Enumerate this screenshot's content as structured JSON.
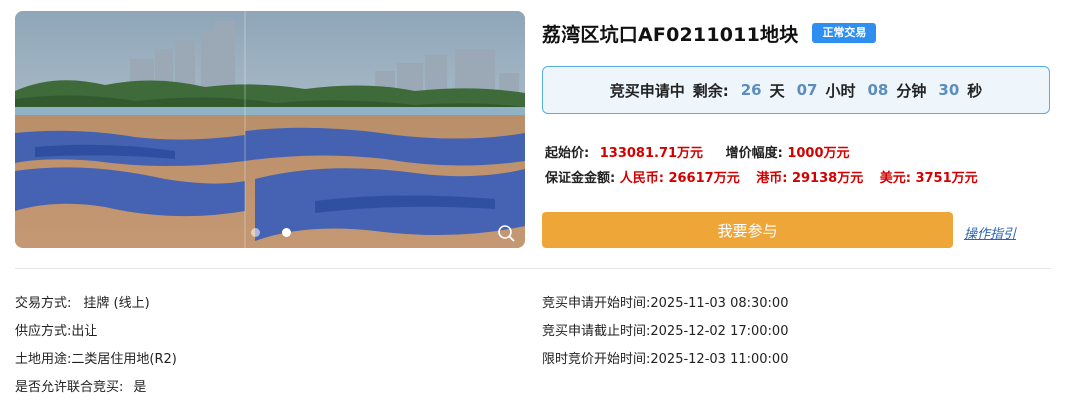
{
  "gallery": {
    "dot_count": 2,
    "active_dot": 1,
    "zoom_icon": "zoom-icon"
  },
  "title": "荔湾区坑口AF0211011地块",
  "badge": "正常交易",
  "countdown": {
    "status": "竞买申请中",
    "remaining_label": "剩余:",
    "days": "26",
    "days_unit": "天",
    "hours": "07",
    "hours_unit": "小时",
    "minutes": "08",
    "minutes_unit": "分钟",
    "seconds": "30",
    "seconds_unit": "秒"
  },
  "prices": {
    "start_label": "起始价:",
    "start_value": "133081.71万元",
    "increment_label": "增价幅度:",
    "increment_value": "1000万元",
    "deposit_label": "保证金金额:",
    "rmb_label": "人民币:",
    "rmb_value": "26617万元",
    "hkd_label": "港币:",
    "hkd_value": "29138万元",
    "usd_label": "美元:",
    "usd_value": "3751万元"
  },
  "join_button": "我要参与",
  "guide_link": "操作指引",
  "details_left": [
    {
      "label": "交易方式:",
      "value": "挂牌 (线上)"
    },
    {
      "label": "供应方式:",
      "value": "出让"
    },
    {
      "label": "土地用途:",
      "value": "二类居住用地(R2)"
    },
    {
      "label": "是否允许联合竞买:",
      "value": "是"
    }
  ],
  "details_right": [
    {
      "label": "竞买申请开始时间:",
      "value": "2025-11-03 08:30:00"
    },
    {
      "label": "竞买申请截止时间:",
      "value": "2025-12-02 17:00:00"
    },
    {
      "label": "限时竞价开始时间:",
      "value": "2025-12-03 11:00:00"
    }
  ],
  "colors": {
    "badge": "#2e8ff0",
    "countdown_border": "#55aee6",
    "countdown_bg": "#eef6fc",
    "countdown_number": "#5b8dbf",
    "price_value": "#d40000",
    "join_button": "#efa639",
    "link": "#2a64b8"
  }
}
